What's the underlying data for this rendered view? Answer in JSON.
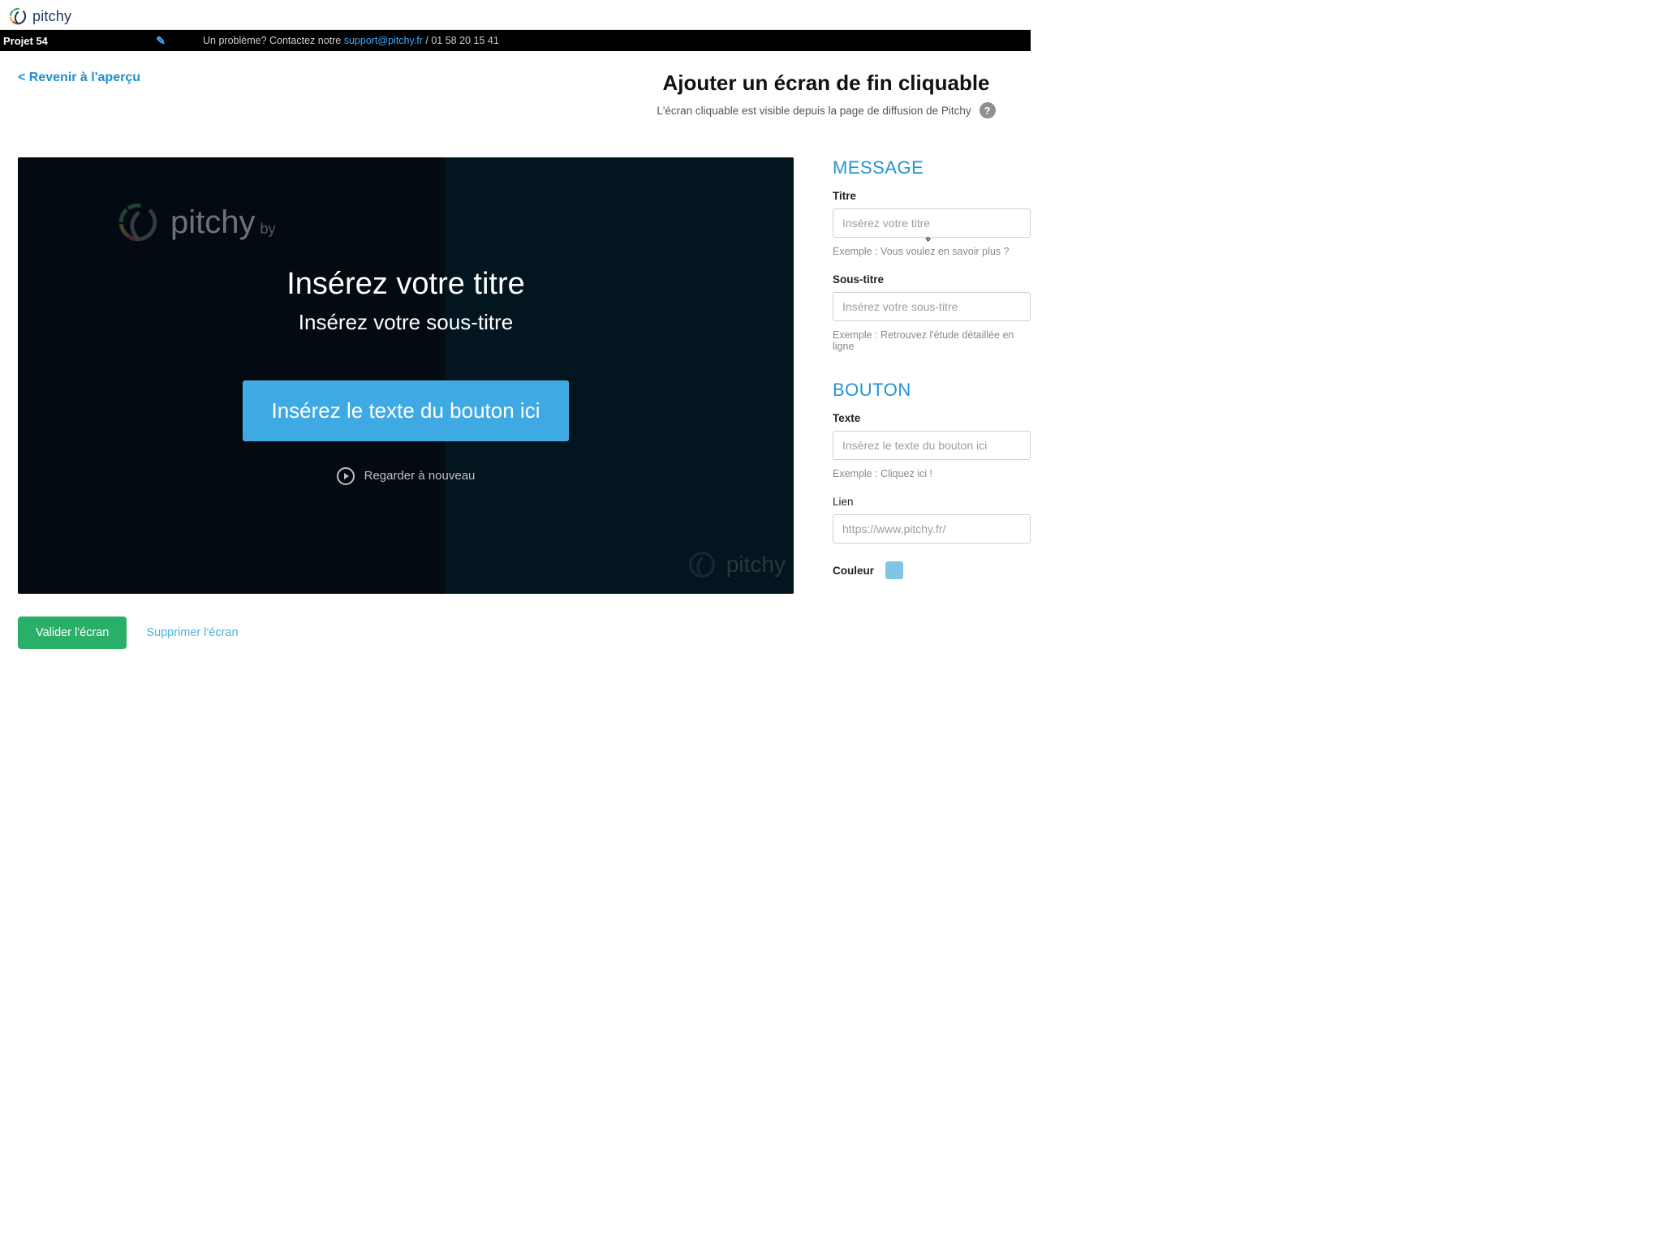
{
  "brand": {
    "name": "pitchy"
  },
  "project": {
    "name": "Projet 54"
  },
  "support": {
    "prefix": "Un problème? Contactez notre ",
    "email": "support@pitchy.fr",
    "suffix": " / 01 58 20 15 41"
  },
  "nav": {
    "back": "< Revenir à l'aperçu"
  },
  "page": {
    "title": "Ajouter un écran de fin cliquable",
    "subtitle": "L'écran cliquable est visible depuis la page de diffusion de Pitchy"
  },
  "preview": {
    "title": "Insérez votre titre",
    "subtitle": "Insérez votre sous-titre",
    "button": "Insérez le texte du bouton ici",
    "rewatch": "Regarder à nouveau",
    "watermark_by": "by"
  },
  "actions": {
    "validate": "Valider l'écran",
    "remove": "Supprimer l'écran"
  },
  "form": {
    "message": {
      "heading": "MESSAGE",
      "title_label": "Titre",
      "title_placeholder": "Insérez votre titre",
      "title_hint": "Exemple : Vous voulez en savoir plus ?",
      "subtitle_label": "Sous-titre",
      "subtitle_placeholder": "Insérez votre sous-titre",
      "subtitle_hint": "Exemple : Retrouvez l'étude détaillée en ligne"
    },
    "button": {
      "heading": "BOUTON",
      "text_label": "Texte",
      "text_placeholder": "Insérez le texte du bouton ici",
      "text_hint": "Exemple : Cliquez ici !",
      "link_label": "Lien",
      "link_placeholder": "https://www.pitchy.fr/",
      "color_label": "Couleur",
      "color_value": "#7fc5e6"
    }
  }
}
